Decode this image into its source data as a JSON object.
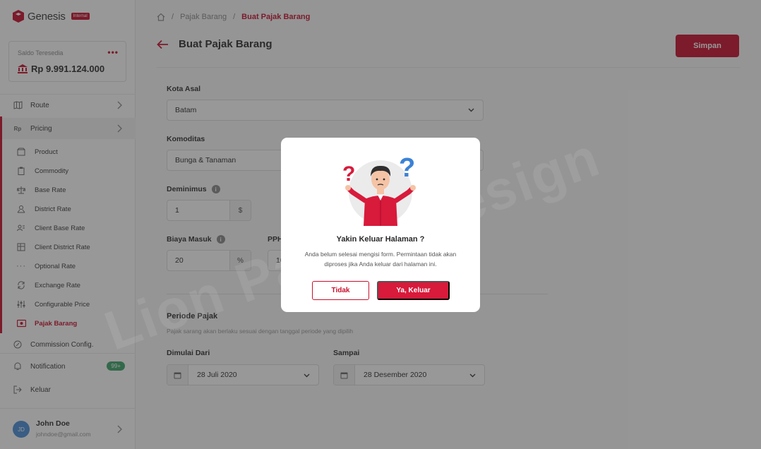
{
  "app": {
    "name": "Genesis",
    "badge": "Internal"
  },
  "balance": {
    "label": "Saldo Teresedia",
    "value": "Rp 9.991.124.000"
  },
  "sidebar": {
    "items": [
      {
        "label": "Route",
        "icon": "map-icon"
      },
      {
        "label": "Pricing",
        "icon": "rupiah-icon"
      }
    ],
    "pricing_sub": [
      {
        "label": "Product",
        "icon": "box-icon"
      },
      {
        "label": "Commodity",
        "icon": "clipboard-icon"
      },
      {
        "label": "Base Rate",
        "icon": "scale-icon"
      },
      {
        "label": "District Rate",
        "icon": "district-icon"
      },
      {
        "label": "Client Base Rate",
        "icon": "client-base-icon"
      },
      {
        "label": "Client District Rate",
        "icon": "client-district-icon"
      },
      {
        "label": "Optional Rate",
        "icon": "dots-icon"
      },
      {
        "label": "Exchange Rate",
        "icon": "exchange-icon"
      },
      {
        "label": "Configurable Price",
        "icon": "sliders-icon"
      },
      {
        "label": "Pajak Barang",
        "icon": "receipt-icon"
      }
    ],
    "bottom": [
      {
        "label": "Commission Config.",
        "icon": "commission-icon"
      },
      {
        "label": "Notification",
        "icon": "bell-icon",
        "badge": "99+"
      },
      {
        "label": "Keluar",
        "icon": "logout-icon"
      }
    ]
  },
  "user": {
    "initials": "JD",
    "name": "John Doe",
    "email": "johndoe@gmail.com"
  },
  "breadcrumb": {
    "sep": "/",
    "parent": "Pajak Barang",
    "current": "Buat Pajak Barang"
  },
  "page": {
    "title": "Buat Pajak Barang",
    "save_label": "Simpan"
  },
  "form": {
    "kota_asal": {
      "label": "Kota Asal",
      "value": "Batam"
    },
    "komoditas": {
      "label": "Komoditas",
      "value": "Bunga & Tanaman"
    },
    "deminimus": {
      "label": "Deminimus",
      "value": "1",
      "suffix": "$"
    },
    "biaya_masuk": {
      "label": "Biaya Masuk",
      "value": "20",
      "suffix": "%"
    },
    "pph": {
      "label": "PPH",
      "value": "10"
    },
    "periode": {
      "label": "Periode Pajak",
      "hint": "Pajak sarang akan berlaku sesuai dengan tanggal periode yang dipilih"
    },
    "mulai": {
      "label": "Dimulai Dari",
      "value": "28 Juli 2020"
    },
    "sampai": {
      "label": "Sampai",
      "value": "28 Desember 2020"
    }
  },
  "modal": {
    "title": "Yakin Keluar Halaman ?",
    "body": "Anda belum selesai mengisi form. Permintaan tidak akan diproses jika Anda keluar dari halaman ini.",
    "cancel": "Tidak",
    "confirm": "Ya, Keluar"
  },
  "watermark": "Lion Parcel Design",
  "colors": {
    "brand": "#c8102e",
    "success": "#3ea66a",
    "avatar": "#4a8fd9"
  }
}
